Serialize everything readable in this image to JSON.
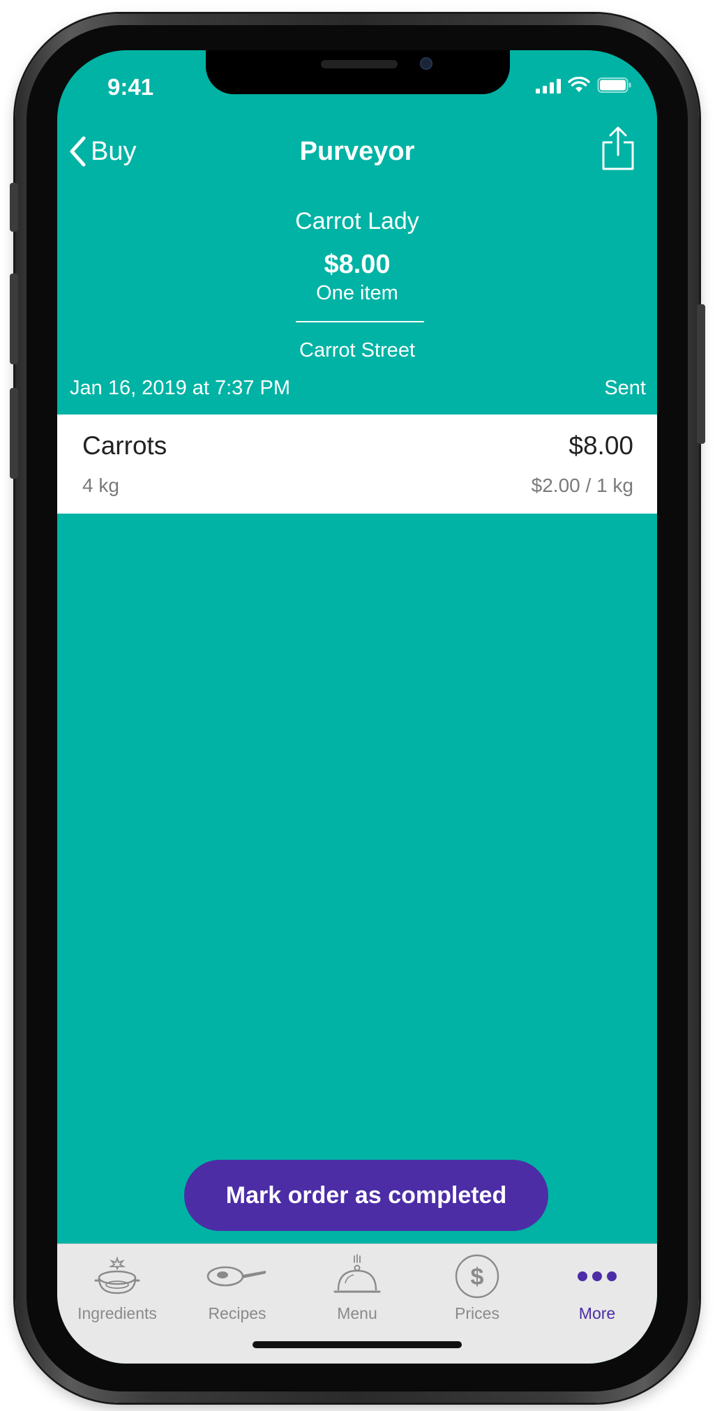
{
  "status_bar": {
    "time": "9:41"
  },
  "nav": {
    "back_label": "Buy",
    "title": "Purveyor"
  },
  "header": {
    "purveyor_name": "Carrot Lady",
    "total": "$8.00",
    "item_count": "One item",
    "location": "Carrot Street",
    "date": "Jan 16, 2019 at 7:37 PM",
    "status": "Sent"
  },
  "items": [
    {
      "name": "Carrots",
      "price": "$8.00",
      "quantity": "4 kg",
      "unit_price": "$2.00 / 1 kg"
    }
  ],
  "action": {
    "complete_label": "Mark order as completed"
  },
  "tabs": [
    {
      "label": "Ingredients",
      "icon": "pot-icon",
      "active": false
    },
    {
      "label": "Recipes",
      "icon": "frying-pan-icon",
      "active": false
    },
    {
      "label": "Menu",
      "icon": "cloche-icon",
      "active": false
    },
    {
      "label": "Prices",
      "icon": "dollar-icon",
      "active": false
    },
    {
      "label": "More",
      "icon": "more-dots-icon",
      "active": true
    }
  ],
  "colors": {
    "background": "#00b3a4",
    "accent": "#4c2da6",
    "tab_bar": "#e8e8e8"
  }
}
